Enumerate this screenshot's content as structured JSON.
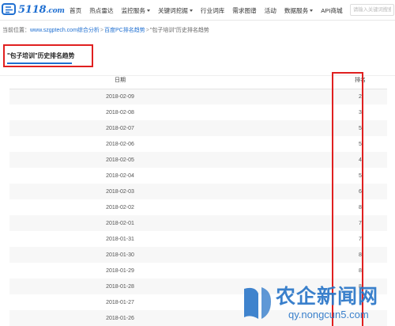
{
  "header": {
    "logo_text": "5118",
    "logo_suffix": ".com",
    "nav": [
      {
        "label": "首页",
        "dropdown": false
      },
      {
        "label": "热点雷达",
        "dropdown": false
      },
      {
        "label": "监控服务",
        "dropdown": true
      },
      {
        "label": "关键词挖掘",
        "dropdown": true
      },
      {
        "label": "行业词库",
        "dropdown": false
      },
      {
        "label": "需求图谱",
        "dropdown": false
      },
      {
        "label": "活动",
        "dropdown": false
      },
      {
        "label": "数据服务",
        "dropdown": true
      },
      {
        "label": "API商城",
        "dropdown": false
      }
    ],
    "search_placeholder": "请输入关键词搜索"
  },
  "breadcrumb": {
    "prefix": "当前位置：",
    "site": "www.szgptech.com综合分析",
    "section": "百度PC排名趋势",
    "current": "\"包子培训\"历史排名趋势"
  },
  "page_title": "\"包子培训\"历史排名趋势",
  "table": {
    "columns": {
      "date": "日期",
      "rank": "排名"
    },
    "rows": [
      {
        "date": "2018-02-09",
        "rank": "2"
      },
      {
        "date": "2018-02-08",
        "rank": "3"
      },
      {
        "date": "2018-02-07",
        "rank": "5"
      },
      {
        "date": "2018-02-06",
        "rank": "5"
      },
      {
        "date": "2018-02-05",
        "rank": "4"
      },
      {
        "date": "2018-02-04",
        "rank": "5"
      },
      {
        "date": "2018-02-03",
        "rank": "6"
      },
      {
        "date": "2018-02-02",
        "rank": "8"
      },
      {
        "date": "2018-02-01",
        "rank": "7"
      },
      {
        "date": "2018-01-31",
        "rank": "7"
      },
      {
        "date": "2018-01-30",
        "rank": "8"
      },
      {
        "date": "2018-01-29",
        "rank": "8"
      },
      {
        "date": "2018-01-28",
        "rank": "8"
      },
      {
        "date": "2018-01-27",
        "rank": ""
      },
      {
        "date": "2018-01-26",
        "rank": ""
      }
    ]
  },
  "watermark": {
    "text": "农企新闻网",
    "url": "qy.nongcun5.com"
  },
  "colors": {
    "brand_blue": "#1f6fd1",
    "highlight_red": "#e02020",
    "watermark_blue": "#2a76c8"
  }
}
